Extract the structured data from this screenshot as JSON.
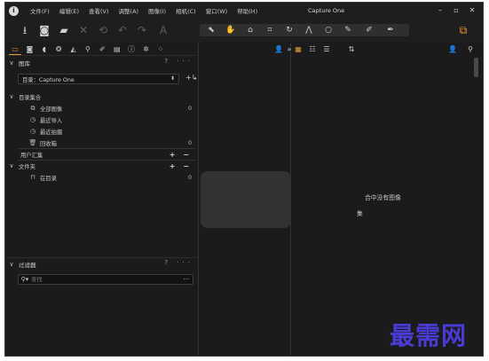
{
  "window": {
    "title": "Capture One"
  },
  "menu": [
    "文件(F)",
    "编辑(E)",
    "查看(V)",
    "调整(A)",
    "图像(I)",
    "相机(C)",
    "窗口(W)",
    "帮助(H)"
  ],
  "library": {
    "title": "图库",
    "catalog_label": "目录：Capture One",
    "catalog_collections_title": "目录集合",
    "items": [
      {
        "label": "全部图像",
        "count": "0",
        "icon": "all-images-icon"
      },
      {
        "label": "最近导入",
        "count": "",
        "icon": "clock-icon"
      },
      {
        "label": "最近拍摄",
        "count": "",
        "icon": "clock-icon"
      },
      {
        "label": "回收箱",
        "count": "0",
        "icon": "trash-icon"
      }
    ],
    "user_collections_title": "用户汇集",
    "folders_title": "文件夹",
    "folder_items": [
      {
        "label": "在目录",
        "count": "0",
        "icon": "book-icon"
      }
    ]
  },
  "filter": {
    "title": "过滤器",
    "search_placeholder": "查找"
  },
  "browser": {
    "empty_message": "合中没有图像",
    "empty_sub": "集"
  },
  "watermark": "最需网",
  "colors": {
    "accent": "#e8943a",
    "background": "#1b1b1b",
    "watermark": "#4a3bd6"
  }
}
